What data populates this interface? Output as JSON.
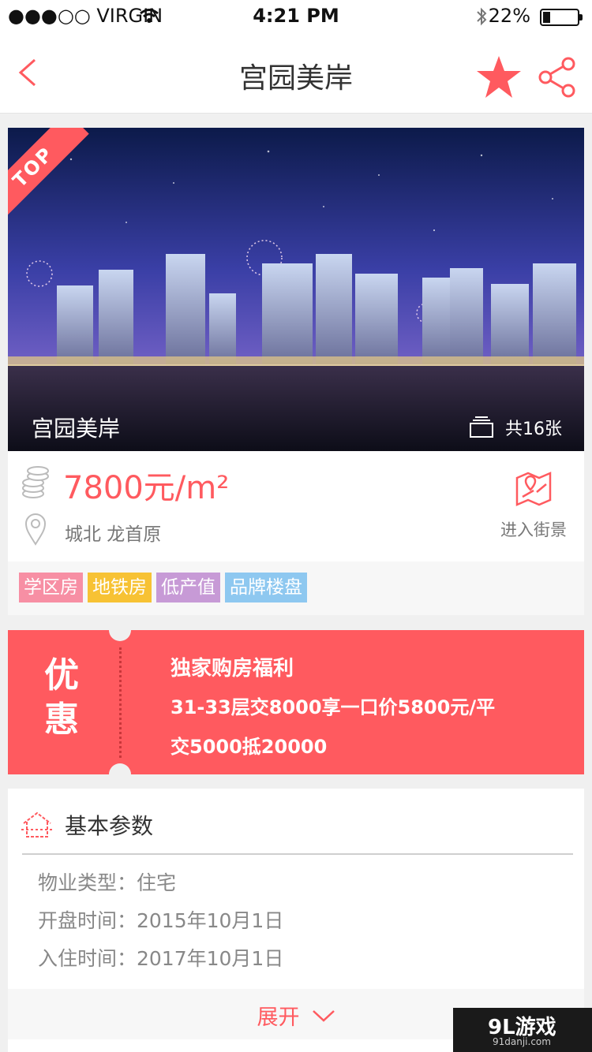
{
  "status_bar": {
    "carrier": "●●●○○ VIRGIN",
    "time": "4:21 PM",
    "battery": "22%",
    "battery_level": 0.22
  },
  "nav": {
    "title": "宫园美岸"
  },
  "hero": {
    "ribbon": "TOP",
    "caption": "宫园美岸",
    "count": "共16张"
  },
  "info": {
    "price": "7800元/m²",
    "location": "城北  龙首原",
    "streetview_label": "进入街景"
  },
  "tags": [
    {
      "label": "学区房",
      "color": "#f78fa4"
    },
    {
      "label": "地铁房",
      "color": "#f7c234"
    },
    {
      "label": "低产值",
      "color": "#c79ad6"
    },
    {
      "label": "品牌楼盘",
      "color": "#8ec8f0"
    }
  ],
  "coupon": {
    "badge": "优惠",
    "title": "独家购房福利",
    "line1": "31-33层交8000享一口价5800元/平",
    "line2": "交5000抵20000"
  },
  "params": {
    "heading": "基本参数",
    "rows": [
      {
        "text": "物业类型：住宅"
      },
      {
        "text": "开盘时间：2015年10月1日"
      },
      {
        "text": "入住时间：2017年10月1日"
      }
    ],
    "expand_label": "展开"
  },
  "watermark": {
    "main": "9L游戏",
    "sub": "91danji.com"
  },
  "colors": {
    "accent": "#ff5a5f"
  }
}
